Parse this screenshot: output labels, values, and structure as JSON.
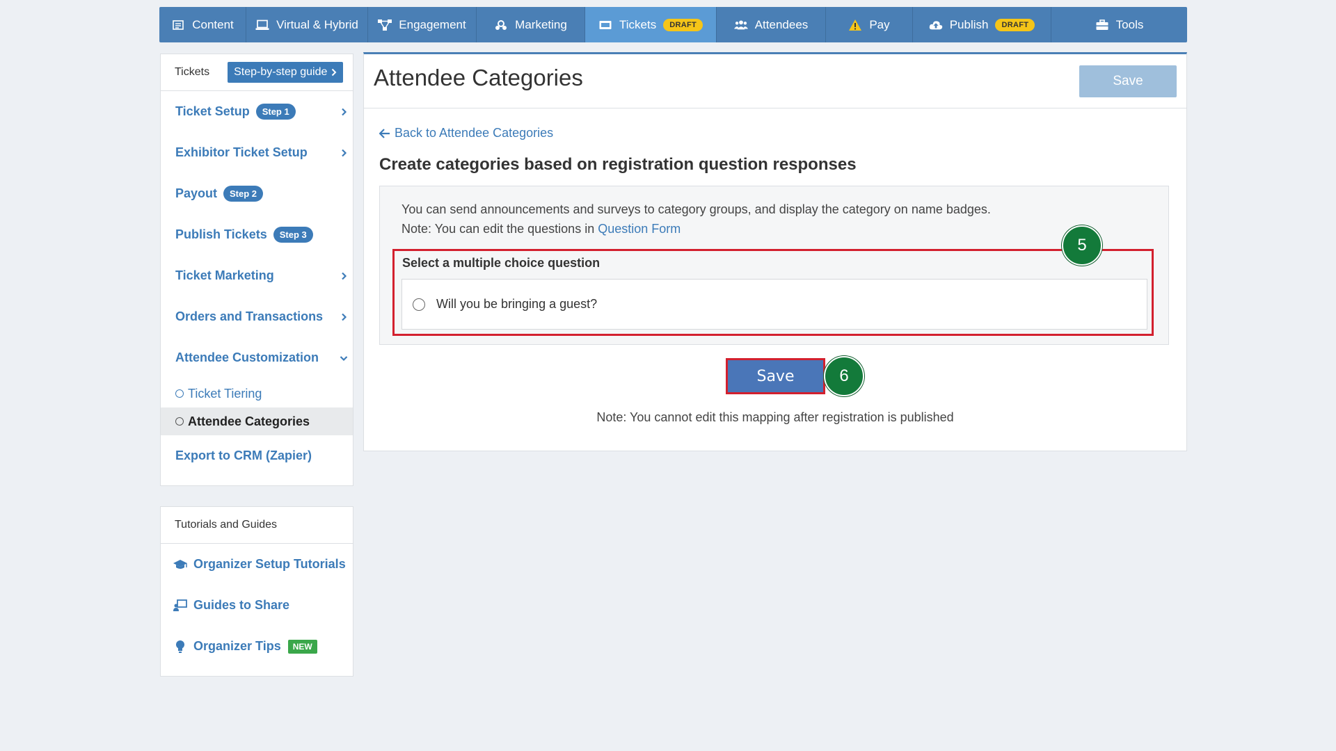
{
  "nav": {
    "items": [
      {
        "label": "Content",
        "icon": "content-icon"
      },
      {
        "label": "Virtual & Hybrid",
        "icon": "laptop-icon"
      },
      {
        "label": "Engagement",
        "icon": "network-icon"
      },
      {
        "label": "Marketing",
        "icon": "marketing-icon"
      },
      {
        "label": "Tickets",
        "icon": "ticket-icon",
        "badge": "DRAFT",
        "active": true
      },
      {
        "label": "Attendees",
        "icon": "users-icon"
      },
      {
        "label": "Pay",
        "icon": "warning-icon"
      },
      {
        "label": "Publish",
        "icon": "cloud-upload-icon",
        "badge": "DRAFT"
      },
      {
        "label": "Tools",
        "icon": "toolbox-icon"
      }
    ]
  },
  "sidebar": {
    "title": "Tickets",
    "guide_button": "Step-by-step guide",
    "items": [
      {
        "label": "Ticket Setup",
        "badge": "Step 1",
        "chevron": "right"
      },
      {
        "label": "Exhibitor Ticket Setup",
        "chevron": "right"
      },
      {
        "label": "Payout",
        "badge": "Step 2"
      },
      {
        "label": "Publish Tickets",
        "badge": "Step 3"
      },
      {
        "label": "Ticket Marketing",
        "chevron": "right"
      },
      {
        "label": "Orders and Transactions",
        "chevron": "right"
      },
      {
        "label": "Attendee Customization",
        "chevron": "down"
      }
    ],
    "subitems": [
      {
        "label": "Ticket Tiering"
      },
      {
        "label": "Attendee Categories",
        "active": true
      }
    ],
    "export_item": "Export to CRM (Zapier)"
  },
  "tutorials": {
    "title": "Tutorials and Guides",
    "items": [
      {
        "label": "Organizer Setup Tutorials",
        "icon": "graduation-cap-icon"
      },
      {
        "label": "Guides to Share",
        "icon": "share-guide-icon"
      },
      {
        "label": "Organizer Tips",
        "icon": "lightbulb-icon",
        "badge": "NEW"
      }
    ]
  },
  "main": {
    "title": "Attendee Categories",
    "save_top": "Save",
    "back_link": "Back to Attendee Categories",
    "section_title": "Create categories based on registration question responses",
    "info_line1": "You can send announcements and surveys to category groups, and display the category on name badges.",
    "info_line2_prefix": "Note: You can edit the questions in ",
    "info_line2_link": "Question Form",
    "question_label": "Select a multiple choice question",
    "question_option": "Will you be bringing a guest?",
    "save_main": "Save",
    "note": "Note: You cannot edit this mapping after registration is published"
  },
  "annotations": {
    "step5": "5",
    "step6": "6"
  },
  "colors": {
    "nav_bg": "#4a7fb5",
    "nav_active": "#5b9bd5",
    "link": "#3c7bb8",
    "draft_badge": "#f5c518",
    "new_badge": "#3aa74a",
    "highlight": "#d3202e",
    "step_circle": "#137a3a"
  }
}
